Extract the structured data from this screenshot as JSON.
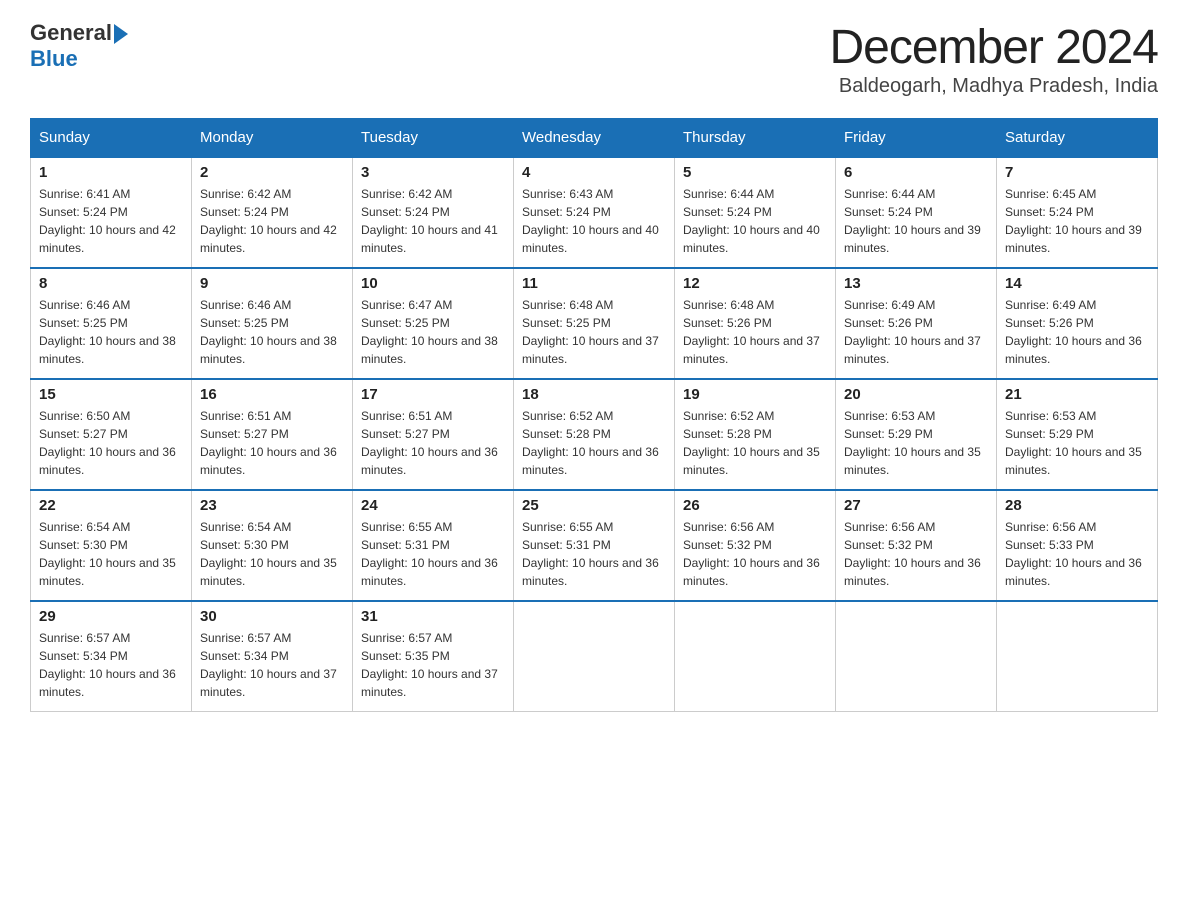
{
  "header": {
    "logo_text_general": "General",
    "logo_text_blue": "Blue",
    "title": "December 2024",
    "subtitle": "Baldeogarh, Madhya Pradesh, India"
  },
  "days_of_week": [
    "Sunday",
    "Monday",
    "Tuesday",
    "Wednesday",
    "Thursday",
    "Friday",
    "Saturday"
  ],
  "weeks": [
    [
      {
        "day": "1",
        "sunrise": "6:41 AM",
        "sunset": "5:24 PM",
        "daylight": "10 hours and 42 minutes."
      },
      {
        "day": "2",
        "sunrise": "6:42 AM",
        "sunset": "5:24 PM",
        "daylight": "10 hours and 42 minutes."
      },
      {
        "day": "3",
        "sunrise": "6:42 AM",
        "sunset": "5:24 PM",
        "daylight": "10 hours and 41 minutes."
      },
      {
        "day": "4",
        "sunrise": "6:43 AM",
        "sunset": "5:24 PM",
        "daylight": "10 hours and 40 minutes."
      },
      {
        "day": "5",
        "sunrise": "6:44 AM",
        "sunset": "5:24 PM",
        "daylight": "10 hours and 40 minutes."
      },
      {
        "day": "6",
        "sunrise": "6:44 AM",
        "sunset": "5:24 PM",
        "daylight": "10 hours and 39 minutes."
      },
      {
        "day": "7",
        "sunrise": "6:45 AM",
        "sunset": "5:24 PM",
        "daylight": "10 hours and 39 minutes."
      }
    ],
    [
      {
        "day": "8",
        "sunrise": "6:46 AM",
        "sunset": "5:25 PM",
        "daylight": "10 hours and 38 minutes."
      },
      {
        "day": "9",
        "sunrise": "6:46 AM",
        "sunset": "5:25 PM",
        "daylight": "10 hours and 38 minutes."
      },
      {
        "day": "10",
        "sunrise": "6:47 AM",
        "sunset": "5:25 PM",
        "daylight": "10 hours and 38 minutes."
      },
      {
        "day": "11",
        "sunrise": "6:48 AM",
        "sunset": "5:25 PM",
        "daylight": "10 hours and 37 minutes."
      },
      {
        "day": "12",
        "sunrise": "6:48 AM",
        "sunset": "5:26 PM",
        "daylight": "10 hours and 37 minutes."
      },
      {
        "day": "13",
        "sunrise": "6:49 AM",
        "sunset": "5:26 PM",
        "daylight": "10 hours and 37 minutes."
      },
      {
        "day": "14",
        "sunrise": "6:49 AM",
        "sunset": "5:26 PM",
        "daylight": "10 hours and 36 minutes."
      }
    ],
    [
      {
        "day": "15",
        "sunrise": "6:50 AM",
        "sunset": "5:27 PM",
        "daylight": "10 hours and 36 minutes."
      },
      {
        "day": "16",
        "sunrise": "6:51 AM",
        "sunset": "5:27 PM",
        "daylight": "10 hours and 36 minutes."
      },
      {
        "day": "17",
        "sunrise": "6:51 AM",
        "sunset": "5:27 PM",
        "daylight": "10 hours and 36 minutes."
      },
      {
        "day": "18",
        "sunrise": "6:52 AM",
        "sunset": "5:28 PM",
        "daylight": "10 hours and 36 minutes."
      },
      {
        "day": "19",
        "sunrise": "6:52 AM",
        "sunset": "5:28 PM",
        "daylight": "10 hours and 35 minutes."
      },
      {
        "day": "20",
        "sunrise": "6:53 AM",
        "sunset": "5:29 PM",
        "daylight": "10 hours and 35 minutes."
      },
      {
        "day": "21",
        "sunrise": "6:53 AM",
        "sunset": "5:29 PM",
        "daylight": "10 hours and 35 minutes."
      }
    ],
    [
      {
        "day": "22",
        "sunrise": "6:54 AM",
        "sunset": "5:30 PM",
        "daylight": "10 hours and 35 minutes."
      },
      {
        "day": "23",
        "sunrise": "6:54 AM",
        "sunset": "5:30 PM",
        "daylight": "10 hours and 35 minutes."
      },
      {
        "day": "24",
        "sunrise": "6:55 AM",
        "sunset": "5:31 PM",
        "daylight": "10 hours and 36 minutes."
      },
      {
        "day": "25",
        "sunrise": "6:55 AM",
        "sunset": "5:31 PM",
        "daylight": "10 hours and 36 minutes."
      },
      {
        "day": "26",
        "sunrise": "6:56 AM",
        "sunset": "5:32 PM",
        "daylight": "10 hours and 36 minutes."
      },
      {
        "day": "27",
        "sunrise": "6:56 AM",
        "sunset": "5:32 PM",
        "daylight": "10 hours and 36 minutes."
      },
      {
        "day": "28",
        "sunrise": "6:56 AM",
        "sunset": "5:33 PM",
        "daylight": "10 hours and 36 minutes."
      }
    ],
    [
      {
        "day": "29",
        "sunrise": "6:57 AM",
        "sunset": "5:34 PM",
        "daylight": "10 hours and 36 minutes."
      },
      {
        "day": "30",
        "sunrise": "6:57 AM",
        "sunset": "5:34 PM",
        "daylight": "10 hours and 37 minutes."
      },
      {
        "day": "31",
        "sunrise": "6:57 AM",
        "sunset": "5:35 PM",
        "daylight": "10 hours and 37 minutes."
      },
      null,
      null,
      null,
      null
    ]
  ]
}
